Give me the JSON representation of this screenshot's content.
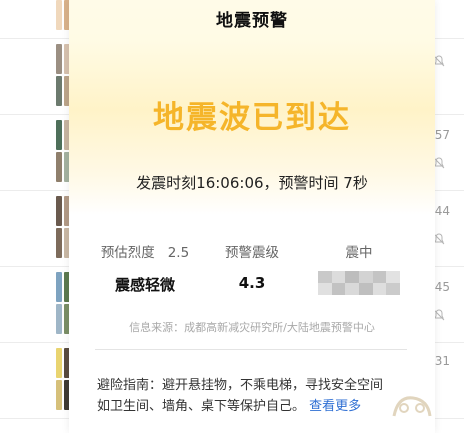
{
  "background": {
    "rows": [
      {
        "meta": "",
        "avatar_colors": [
          "#e7c9a5",
          "#c49a6c",
          "#f0d8bc",
          "#d9b28a"
        ]
      },
      {
        "meta": "",
        "avatar_colors": [
          "#9b8f82",
          "#d7c2ae",
          "#6c7a6e",
          "#bca58a"
        ]
      },
      {
        "meta": "57",
        "avatar_colors": [
          "#4e6f5a",
          "#c8b4a0",
          "#8f7f6c",
          "#a4b2a0"
        ]
      },
      {
        "meta": "44",
        "avatar_colors": [
          "#6a5a4e",
          "#b39b87",
          "#7d6b5b",
          "#c9b8a5"
        ]
      },
      {
        "meta": "45",
        "avatar_colors": [
          "#7ea3c0",
          "#5d7a4f",
          "#9fb6c7",
          "#7b8f66"
        ]
      },
      {
        "meta": "31",
        "avatar_colors": [
          "#e9d470",
          "#5a4c40",
          "#d6c07a",
          "#3f3a33"
        ]
      }
    ],
    "mute_icon": "bell-off-icon"
  },
  "dialog": {
    "title": "地震预警",
    "headline": "地震波已到达",
    "time_line": "发震时刻16:06:06，预警时间 7秒",
    "intensity": {
      "label": "预估烈度",
      "label_value": "2.5",
      "value": "震感轻微"
    },
    "magnitude": {
      "label": "预警震级",
      "value": "4.3"
    },
    "epicenter": {
      "label": "震中",
      "value_hidden": true
    },
    "source": "信息来源：成都高新减灾研究所/大陆地震预警中心",
    "guide_line1": "避险指南：避开悬挂物，不乘电梯，寻找安全空间",
    "guide_line2": "如卫生间、墙角、桌下等保护自己。",
    "more_link": "查看更多"
  },
  "colors": {
    "headline": "#f5b52a",
    "link": "#2f6fd3",
    "title": "#111111"
  }
}
